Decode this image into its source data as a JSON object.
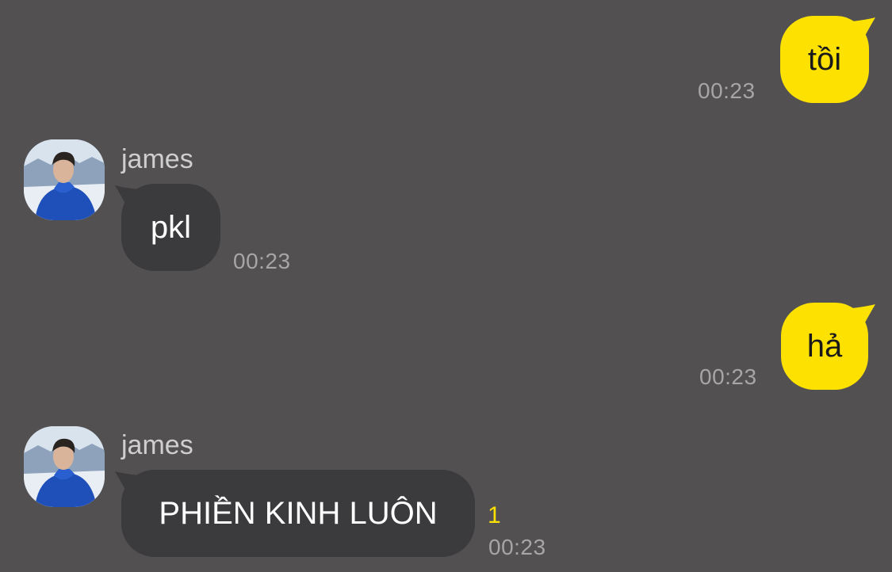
{
  "conversation": {
    "messages": [
      {
        "direction": "outgoing",
        "text": "tồi",
        "time": "00:23"
      },
      {
        "direction": "incoming",
        "sender": "james",
        "text": "pkl",
        "time": "00:23"
      },
      {
        "direction": "outgoing",
        "text": "hả",
        "time": "00:23"
      },
      {
        "direction": "incoming",
        "sender": "james",
        "text": "PHIỀN KINH LUÔN",
        "time": "00:23",
        "unread_count": "1"
      }
    ]
  },
  "colors": {
    "background": "#525051",
    "incoming_bubble": "#3b3a3c",
    "outgoing_bubble": "#fde201",
    "timestamp": "#a6a6a6",
    "sender_name": "#cfcfcf",
    "unread_count": "#fde201"
  },
  "icons": {
    "avatar": "profile-photo"
  }
}
